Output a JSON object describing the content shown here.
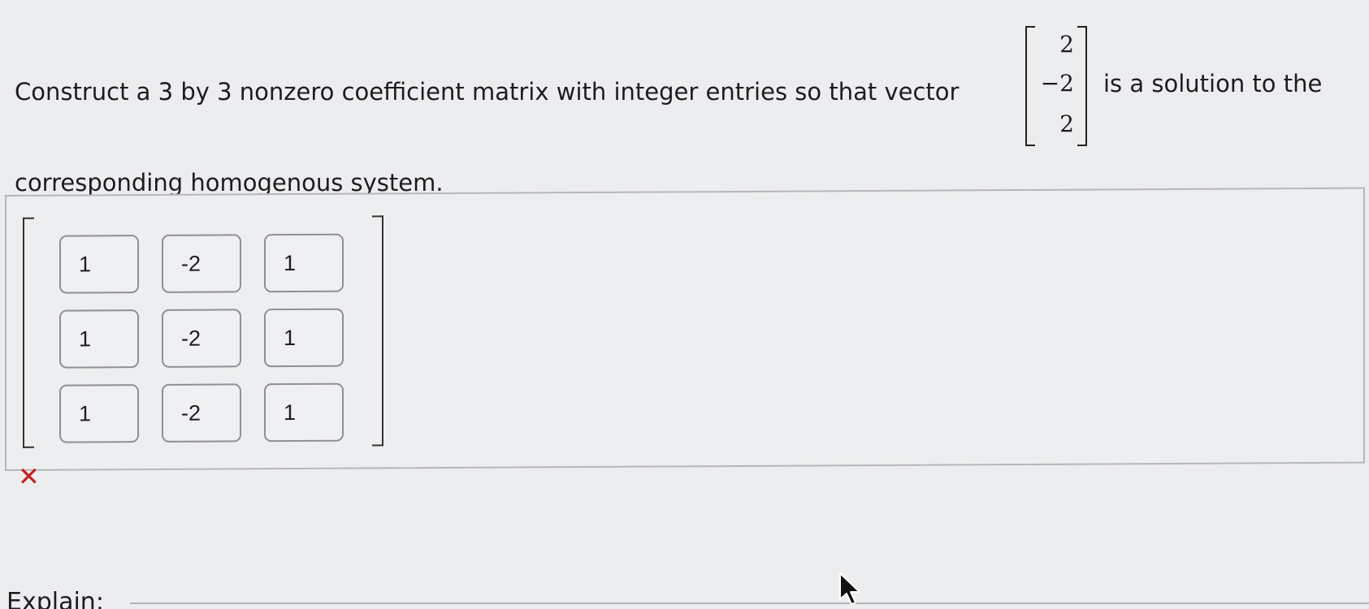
{
  "question": {
    "text_before": "Construct a 3 by 3 nonzero coefficient matrix with integer entries so that vector",
    "text_after": "is a solution to the",
    "text_line2": "corresponding homogenous system.",
    "vector": [
      "2",
      "−2",
      "2"
    ]
  },
  "answer": {
    "matrix": [
      [
        "1",
        "-2",
        "1"
      ],
      [
        "1",
        "-2",
        "1"
      ],
      [
        "1",
        "-2",
        "1"
      ]
    ],
    "status_icon": "✕",
    "status": "incorrect",
    "status_color": "#c0231f"
  },
  "explain_label": "Explain:",
  "icons": {
    "incorrect": "close-icon",
    "cursor": "mouse-pointer-icon"
  }
}
